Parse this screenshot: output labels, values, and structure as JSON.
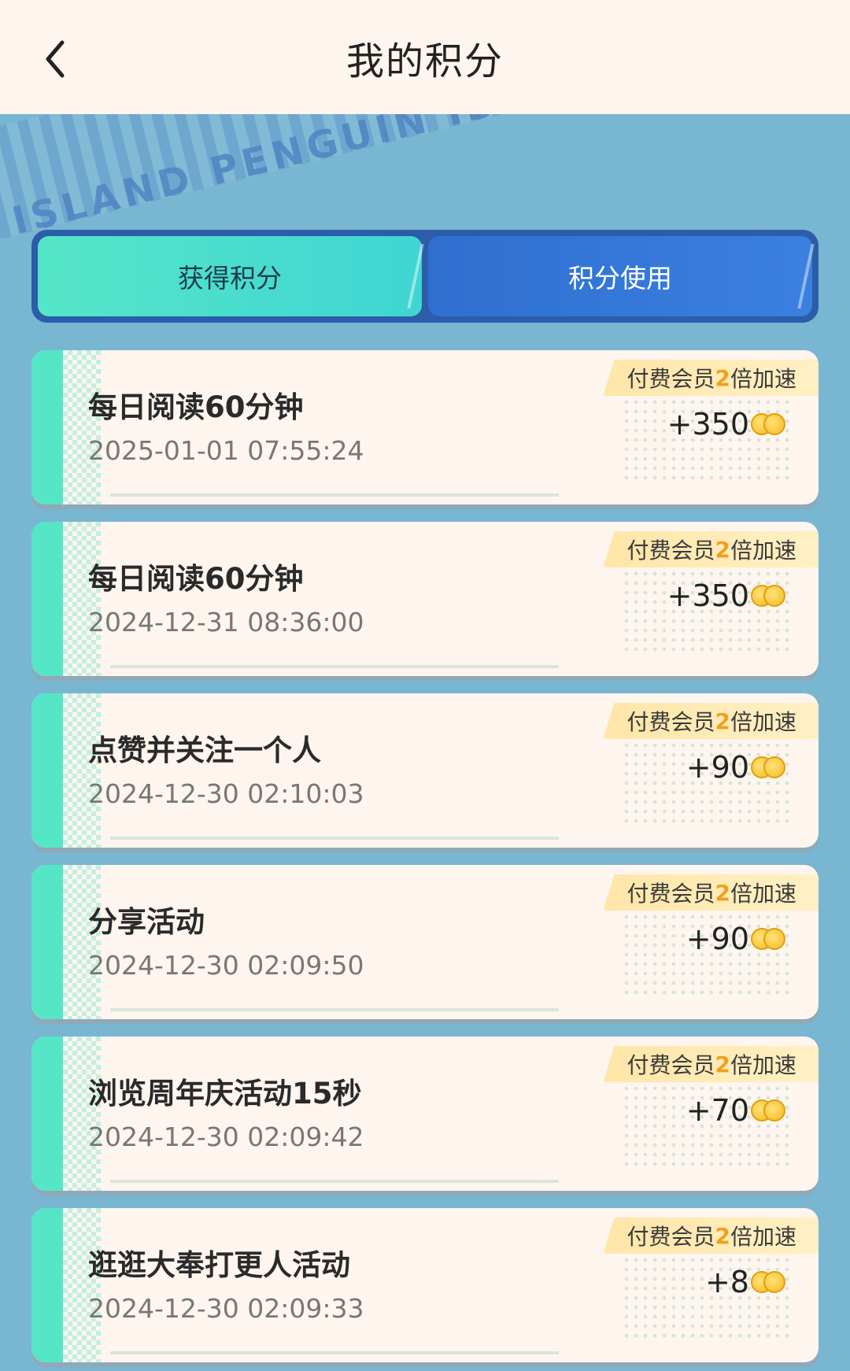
{
  "header": {
    "title": "我的积分"
  },
  "banner": {
    "text": "ISLAND  PENGUIN  ISLAND"
  },
  "tabs": [
    {
      "label": "获得积分",
      "active": true
    },
    {
      "label": "积分使用",
      "active": false
    }
  ],
  "badge_parts": {
    "prefix": "付费会员",
    "num": "2",
    "suffix": "倍加速"
  },
  "records": [
    {
      "title": "每日阅读60分钟",
      "time": "2025-01-01 07:55:24",
      "points": "+350"
    },
    {
      "title": "每日阅读60分钟",
      "time": "2024-12-31 08:36:00",
      "points": "+350"
    },
    {
      "title": "点赞并关注一个人",
      "time": "2024-12-30 02:10:03",
      "points": "+90"
    },
    {
      "title": "分享活动",
      "time": "2024-12-30 02:09:50",
      "points": "+90"
    },
    {
      "title": "浏览周年庆活动15秒",
      "time": "2024-12-30 02:09:42",
      "points": "+70"
    },
    {
      "title": "逛逛大奉打更人活动",
      "time": "2024-12-30 02:09:33",
      "points": "+8"
    }
  ],
  "colors": {
    "background": "#78b6d1",
    "active_tab": "#55e6c8",
    "inactive_tab": "#2f6fd0",
    "accent_badge": "#f0a020"
  },
  "icons": [
    "chevron-left-icon",
    "coin-icon"
  ]
}
